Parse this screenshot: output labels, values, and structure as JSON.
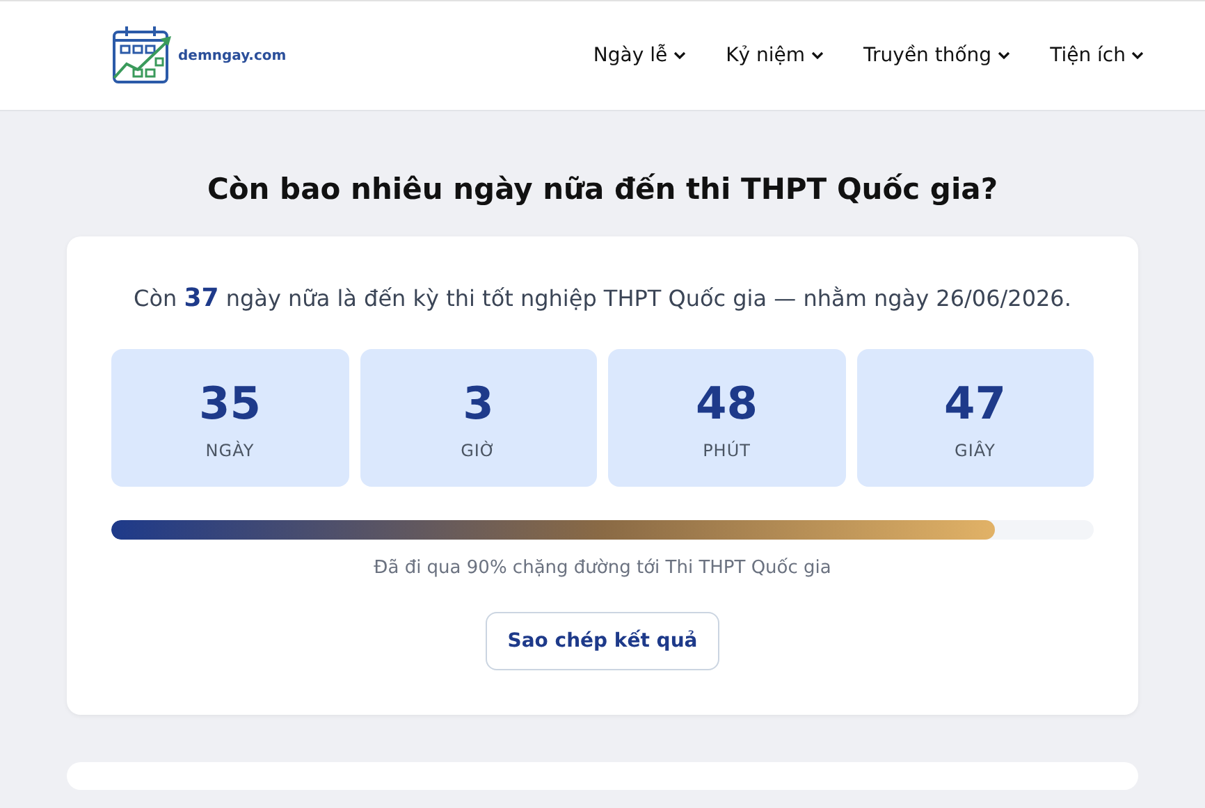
{
  "logo": {
    "text": "demngay.com"
  },
  "nav": [
    {
      "label": "Ngày lễ"
    },
    {
      "label": "Kỷ niệm"
    },
    {
      "label": "Truyền thống"
    },
    {
      "label": "Tiện ích"
    }
  ],
  "title": "Còn bao nhiêu ngày nữa đến thi THPT Quốc gia?",
  "intro": "Còn **37** ngày nữa là đến kỳ thi tốt nghiệp THPT Quốc gia — nhằm ngày 26/06/2026.",
  "counters": [
    {
      "value": "35",
      "unit": "NGÀY"
    },
    {
      "value": "3",
      "unit": "GIỜ"
    },
    {
      "value": "48",
      "unit": "PHÚT"
    },
    {
      "value": "47",
      "unit": "GIÂY"
    }
  ],
  "progress": {
    "level": 0.9,
    "caption": "Đã đi qua 90% chặng đường tới Thi THPT Quốc gia"
  },
  "copy_button": "Sao chép kết quả"
}
